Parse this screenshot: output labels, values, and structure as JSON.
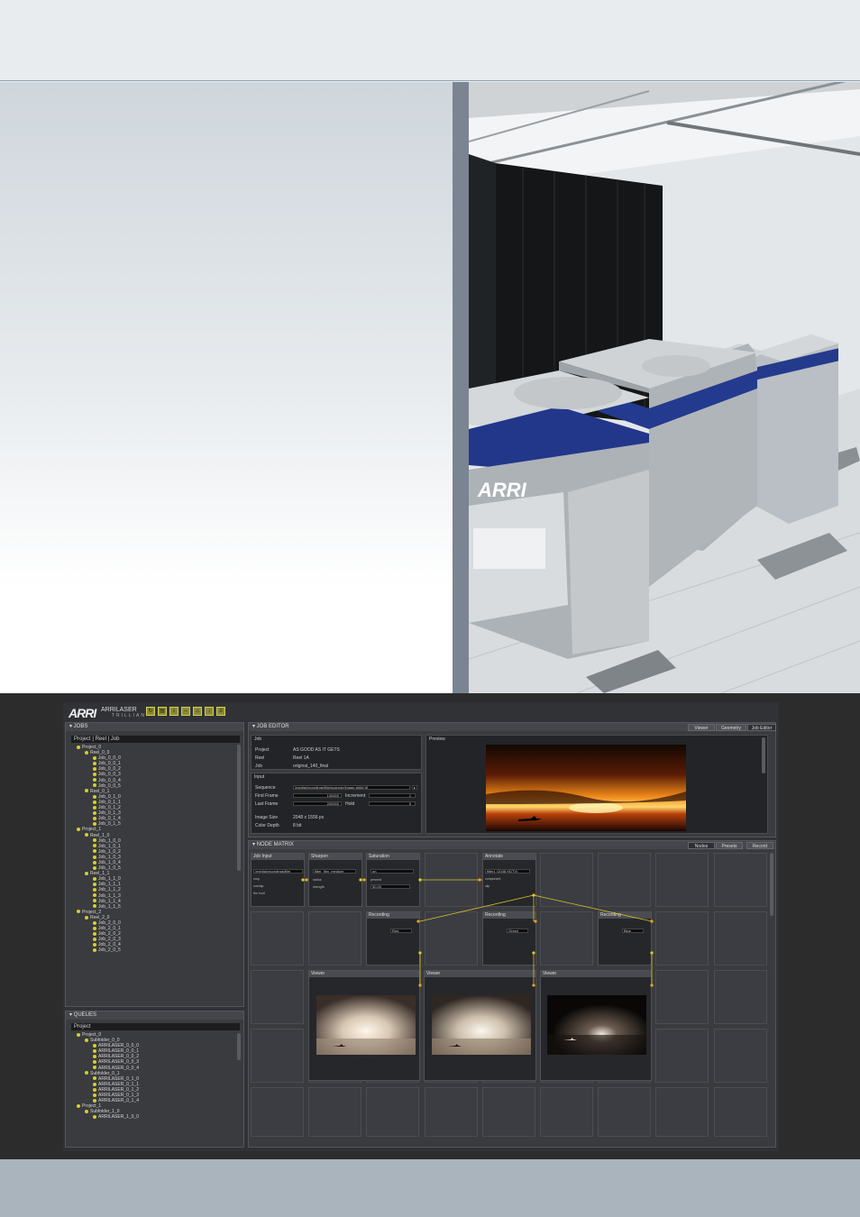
{
  "app": {
    "brand": "ARRI",
    "product": "ARRILASER",
    "product_sub": "TRILLIAN",
    "toolbar_icons": [
      "refresh-icon",
      "clipboard-icon",
      "info-icon",
      "minus-icon",
      "home-icon",
      "download-icon",
      "list-icon"
    ]
  },
  "jobs_panel": {
    "title": "▾ JOBS",
    "header": "Project | Reel | Job",
    "items": [
      "Project_0",
      "Reel_0_0",
      "Job_0_0_0",
      "Job_0_0_1",
      "Job_0_0_2",
      "Job_0_0_3",
      "Job_0_0_4",
      "Job_0_0_5",
      "Reel_0_1",
      "Job_0_1_0",
      "Job_0_1_1",
      "Job_0_1_2",
      "Job_0_1_3",
      "Job_0_1_4",
      "Job_0_1_5",
      "Project_1",
      "Reel_1_0",
      "Job_1_0_0",
      "Job_1_0_1",
      "Job_1_0_2",
      "Job_1_0_3",
      "Job_1_0_4",
      "Job_1_0_5",
      "Reel_1_1",
      "Job_1_1_0",
      "Job_1_1_1",
      "Job_1_1_2",
      "Job_1_1_3",
      "Job_1_1_4",
      "Job_1_1_5",
      "Project_2",
      "Reel_2_0",
      "Job_2_0_0",
      "Job_2_0_1",
      "Job_2_0_2",
      "Job_2_0_3",
      "Job_2_0_4",
      "Job_2_0_5"
    ],
    "levels": [
      0,
      1,
      2,
      2,
      2,
      2,
      2,
      2,
      1,
      2,
      2,
      2,
      2,
      2,
      2,
      0,
      1,
      2,
      2,
      2,
      2,
      2,
      2,
      1,
      2,
      2,
      2,
      2,
      2,
      2,
      0,
      1,
      2,
      2,
      2,
      2,
      2,
      2
    ]
  },
  "queues_panel": {
    "title": "▾ QUEUES",
    "header": "Project",
    "items": [
      "Project_0",
      "Subfolder_0_0",
      "ARRILASER_0_0_0",
      "ARRILASER_0_0_1",
      "ARRILASER_0_0_2",
      "ARRILASER_0_0_3",
      "ARRILASER_0_0_4",
      "Subfolder_0_1",
      "ARRILASER_0_1_0",
      "ARRILASER_0_1_1",
      "ARRILASER_0_1_2",
      "ARRILASER_0_1_3",
      "ARRILASER_0_1_4",
      "Project_1",
      "Subfolder_1_0",
      "ARRILASER_1_0_0"
    ],
    "levels": [
      0,
      1,
      2,
      2,
      2,
      2,
      2,
      1,
      2,
      2,
      2,
      2,
      2,
      0,
      1,
      2
    ]
  },
  "job_editor": {
    "title": "▾ JOB EDITOR",
    "tabs": [
      "Viewer",
      "Geometry",
      "Job Editor"
    ],
    "job": {
      "label": "Job",
      "project_k": "Project",
      "project_v": "AS GOOD AS IT GETS",
      "reel_k": "Reel",
      "reel_v": "Reel 1A",
      "job_k": "Job",
      "job_v": "original_140_final"
    },
    "input": {
      "label": "Input",
      "sequence_k": "Sequence",
      "sequence_v": "/media/recordings/film/scanner/image.####.tif",
      "first_k": "First Frame",
      "first_v": "100000",
      "increment_k": "Increment",
      "increment_v": "1",
      "last_k": "Last Frame",
      "last_v": "200000",
      "hold_k": "Hold",
      "hold_v": "0",
      "size_k": "Image Size",
      "size_v": "2048 x 1556 px",
      "depth_k": "Color Depth",
      "depth_v": "8 bit"
    },
    "preview_label": "Preview"
  },
  "node_matrix": {
    "title": "▾ NODE MATRIX",
    "tabs": [
      "Nodes",
      "Presets",
      "Record"
    ],
    "nodes": {
      "input": {
        "title": "Job Input",
        "r1": "/media/recordings/film",
        "r2": "crop",
        "r3": "overlap",
        "r4": "frm hold"
      },
      "sharpen": {
        "title": "Sharpen",
        "r1": "filter_film_medium",
        "r2": "radius",
        "r3": "strength"
      },
      "saturation": {
        "title": "Saturation",
        "r1": "on",
        "r2": "percent",
        "r3": "50.00"
      },
      "annotate": {
        "title": "Annotate",
        "r1": "filter1 (2048 HDTV)",
        "r2": "component",
        "r3": "clip"
      },
      "rec1": {
        "title": "Recording",
        "channel": "Red"
      },
      "rec2": {
        "title": "Recording",
        "channel": "Green"
      },
      "rec3": {
        "title": "Recording",
        "channel": "Blue"
      },
      "view1": {
        "title": "Viewer"
      },
      "view2": {
        "title": "Viewer"
      },
      "view3": {
        "title": "Viewer"
      }
    }
  },
  "colors": {
    "accent": "#d6cf2c",
    "link": "#e8a422",
    "panel": "#3a3b3f"
  }
}
